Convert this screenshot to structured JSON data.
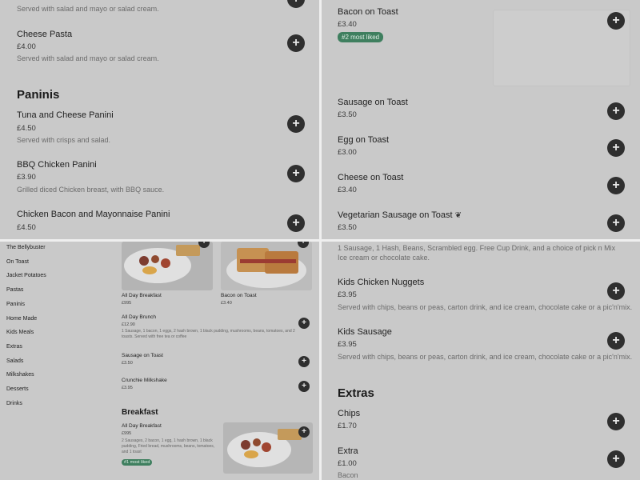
{
  "q1": {
    "top_desc": "Served with salad and mayo or salad cream.",
    "items": [
      {
        "name": "Cheese Pasta",
        "price": "£4.00",
        "desc": "Served with salad and mayo or salad cream."
      }
    ],
    "section": "Paninis",
    "paninis": [
      {
        "name": "Tuna and Cheese Panini",
        "price": "£4.50",
        "desc": "Served with crisps and salad."
      },
      {
        "name": "BBQ Chicken Panini",
        "price": "£3.90",
        "desc": "Grilled diced Chicken breast, with BBQ sauce."
      },
      {
        "name": "Chicken Bacon and Mayonnaise Panini",
        "price": "£4.50"
      }
    ],
    "add_symbol": "+"
  },
  "q2": {
    "items": [
      {
        "name": "Bacon on Toast",
        "price": "£3.40",
        "badge": "#2 most liked"
      },
      {
        "name": "Sausage on Toast",
        "price": "£3.50"
      },
      {
        "name": "Egg on Toast",
        "price": "£3.00"
      },
      {
        "name": "Cheese on Toast",
        "price": "£3.40"
      },
      {
        "name": "Vegetarian Sausage on Toast",
        "price": "£3.50",
        "icon": "leaf-icon"
      }
    ],
    "leaf_symbol": "❦"
  },
  "q3": {
    "sidebar": [
      "The Bellybuster",
      "On Toast",
      "Jacket Potatoes",
      "Pastas",
      "Paninis",
      "Home Made",
      "Kids Meals",
      "Extras",
      "Salads",
      "Milkshakes",
      "Desserts",
      "Drinks"
    ],
    "cards": [
      {
        "name": "All Day Breakfast",
        "price": "£995"
      },
      {
        "name": "Bacon on Toast",
        "price": "£3.40"
      }
    ],
    "list": [
      {
        "name": "All Day Brunch",
        "price": "£12.90",
        "desc": "1 Sausage, 1 bacon, 1 eggs, 2 hash brown, 1 black pudding, mushrooms, beans, tomatoes, and 2 toasts. Served with free tea or coffee"
      },
      {
        "name": "Sausage on Toast",
        "price": "£3.50"
      },
      {
        "name": "Crunchie Milkshake",
        "price": "£3.95"
      }
    ],
    "section": "Breakfast",
    "breakfast": {
      "name": "All Day Breakfast",
      "price": "£995",
      "desc": "2 Sausages, 2 bacon, 1 egg, 1 hash brown, 1 black pudding, Fried bread, mushrooms, beans, tomatoes, and 1 toast",
      "badge": "#1 most liked"
    }
  },
  "q4": {
    "top_desc": "1 Sausage, 1 Hash, Beans, Scrambled egg. Free Cup Drink, and a choice of pick n Mix Ice cream or chocolate cake.",
    "items": [
      {
        "name": "Kids Chicken Nuggets",
        "price": "£3.95",
        "desc": "Served with chips, beans or peas, carton drink, and ice cream, chocolate cake or a pic'n'mix."
      },
      {
        "name": "Kids Sausage",
        "price": "£3.95",
        "desc": "Served with chips, beans or peas, carton drink, and ice cream, chocolate cake or a pic'n'mix."
      }
    ],
    "section": "Extras",
    "extras": [
      {
        "name": "Chips",
        "price": "£1.70"
      },
      {
        "name": "Extra",
        "price": "£1.00",
        "desc": "Bacon"
      }
    ]
  }
}
